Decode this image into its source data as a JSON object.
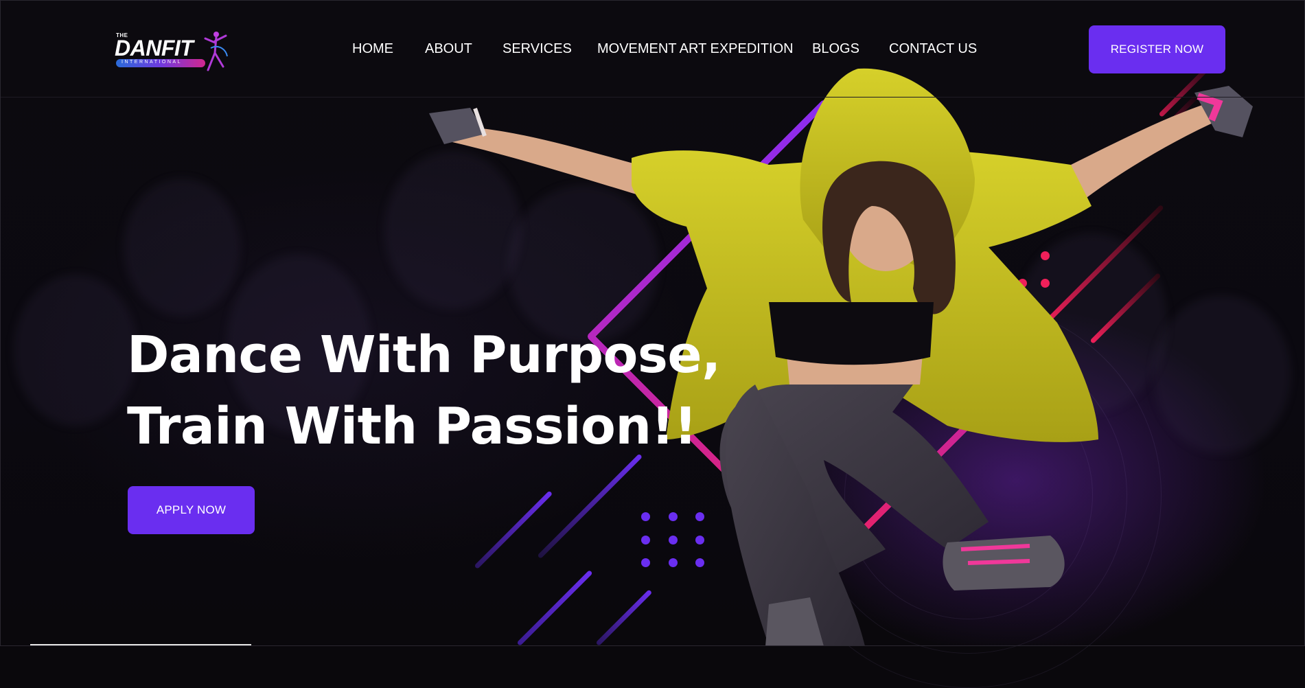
{
  "header": {
    "logo": {
      "small_text": "THE",
      "main_text": "DANFIT",
      "sub_text": "INTERNATIONAL"
    },
    "nav": [
      {
        "label": "HOME"
      },
      {
        "label": "ABOUT"
      },
      {
        "label": "SERVICES"
      },
      {
        "label": "MOVEMENT ART EXPEDITION"
      },
      {
        "label": "BLOGS"
      },
      {
        "label": "CONTACT US"
      }
    ],
    "register_button": "REGISTER NOW"
  },
  "hero": {
    "headline_line1": "Dance With Purpose,",
    "headline_line2": "Train With Passion!!",
    "apply_button": "APPLY NOW",
    "image": "dancer-in-yellow-hoodie-jumping"
  },
  "colors": {
    "accent": "#6a2ef0",
    "background": "#0a080c",
    "pink": "#f0205a",
    "hoodie": "#c8c220"
  }
}
